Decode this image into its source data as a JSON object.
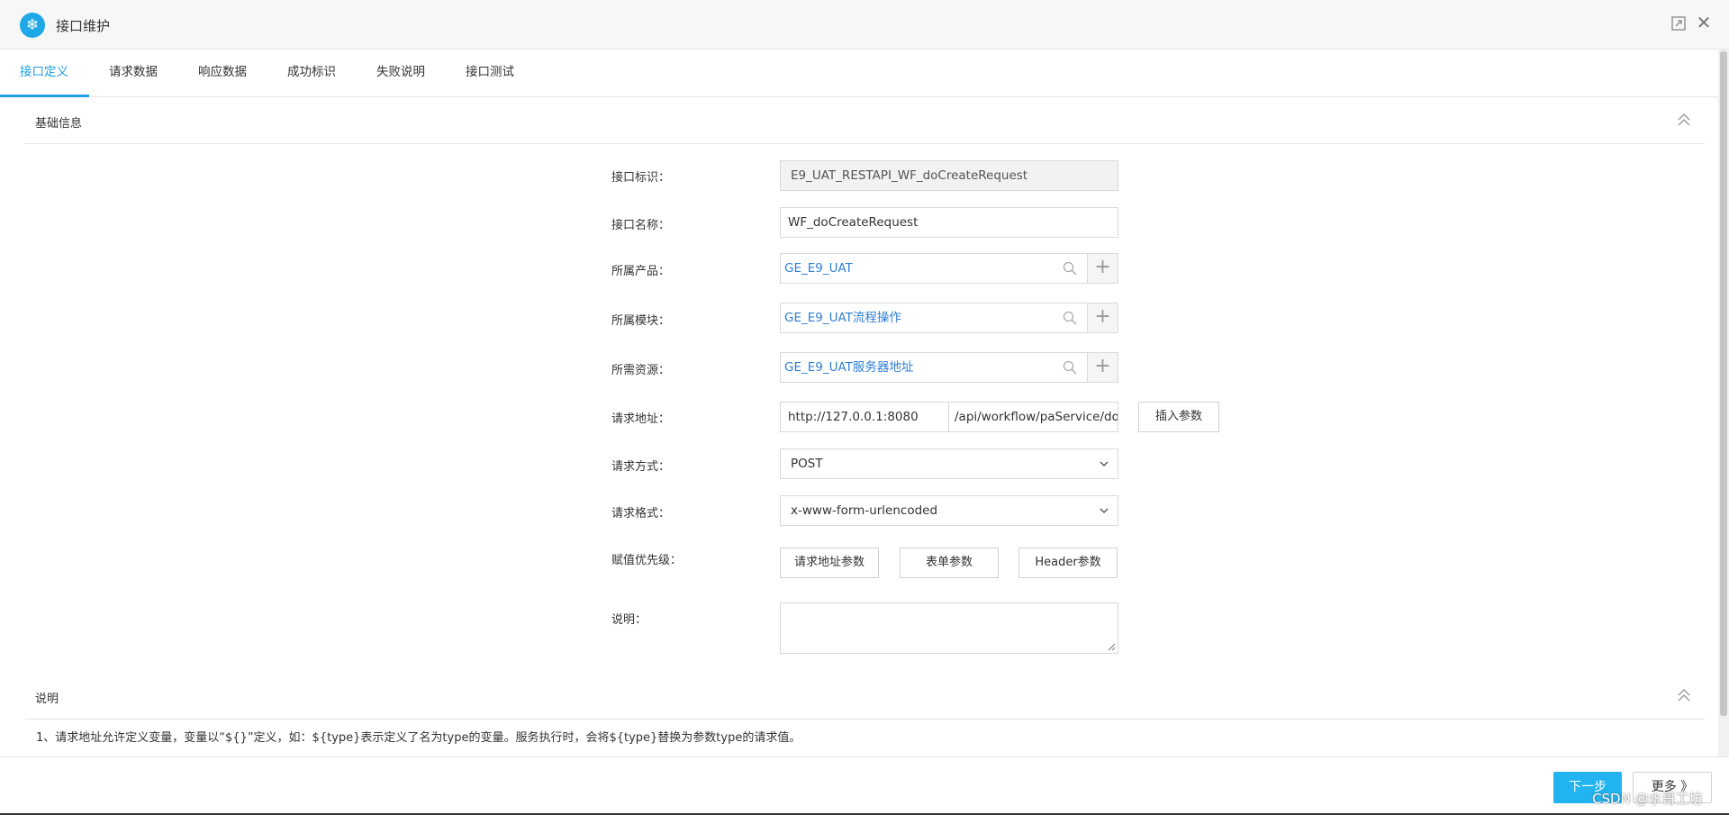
{
  "window": {
    "title": "接口维护",
    "icon": "snowflake-icon",
    "restore_icon": "restore-icon",
    "close_icon": "close-icon"
  },
  "tabs": [
    {
      "label": "接口定义",
      "active": true
    },
    {
      "label": "请求数据",
      "active": false
    },
    {
      "label": "响应数据",
      "active": false
    },
    {
      "label": "成功标识",
      "active": false
    },
    {
      "label": "失败说明",
      "active": false
    },
    {
      "label": "接口测试",
      "active": false
    }
  ],
  "basic_info": {
    "title": "基础信息",
    "fields": {
      "interface_id": {
        "label": "接口标识：",
        "value": "E9_UAT_RESTAPI_WF_doCreateRequest"
      },
      "interface_name": {
        "label": "接口名称：",
        "value": "WF_doCreateRequest"
      },
      "product": {
        "label": "所属产品：",
        "value": "GE_E9_UAT"
      },
      "module": {
        "label": "所属模块：",
        "value": "GE_E9_UAT流程操作"
      },
      "resource": {
        "label": "所需资源：",
        "value": "GE_E9_UAT服务器地址"
      },
      "request_url": {
        "label": "请求地址：",
        "host": "http://127.0.0.1:8080",
        "path": "/api/workflow/paService/doCreateRequest",
        "insert_button": "插入参数"
      },
      "request_method": {
        "label": "请求方式：",
        "value": "POST"
      },
      "request_format": {
        "label": "请求格式：",
        "value": "x-www-form-urlencoded"
      },
      "priority": {
        "label": "赋值优先级：",
        "options": [
          "请求地址参数",
          "表单参数",
          "Header参数"
        ]
      },
      "description": {
        "label": "说明：",
        "value": ""
      }
    }
  },
  "notes": {
    "title": "说明",
    "items": [
      "1、请求地址允许定义变量，变量以“${}”定义，如：${type}表示定义了名为type的变量。服务执行时，会将${type}替换为参数type的请求值。"
    ]
  },
  "footer": {
    "next_label": "下一步",
    "more_label": "更多 》",
    "watermark": "CSDN @水哥工坊"
  },
  "colors": {
    "accent": "#1fa0e6",
    "link": "#2f7fd5",
    "primary_button": "#22b4f0"
  }
}
